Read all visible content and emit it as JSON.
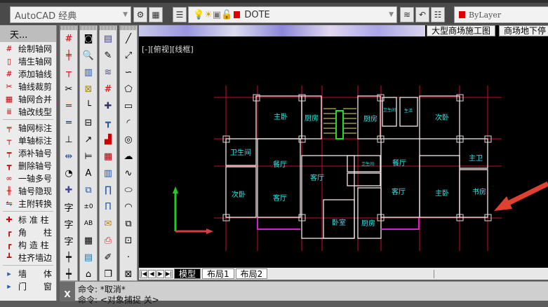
{
  "toolbar": {
    "workspace": "AutoCAD 经典",
    "layer": "DOTE",
    "color": "ByLayer",
    "layer_color": "#e00000"
  },
  "palette": {
    "title": "天...",
    "groups": [
      [
        "绘制轴网",
        "墙生轴网",
        "添加轴线",
        "轴线裁剪",
        "轴网合并",
        "轴改线型"
      ],
      [
        "轴网标注",
        "单轴标注",
        "添补轴号",
        "删除轴号",
        "一轴多号",
        "轴号隐现",
        "主附转换"
      ],
      [
        "标 准 柱",
        "角　　柱",
        "构 造 柱",
        "柱齐墙边"
      ],
      [
        "墙　　体",
        "门　　窗"
      ]
    ]
  },
  "doc_tabs": [
    "大型商场施工图",
    "商场地下停"
  ],
  "viewport_label": "[-][俯视][线框]",
  "layout_tabs": [
    "模型",
    "布局1",
    "布局2"
  ],
  "command": {
    "line1": "命令:  *取消*",
    "line2": "命令:  <对象捕捉 关>"
  },
  "rooms": {
    "master_left": "主卧",
    "kitchen_l": "厨房",
    "kitchen_r": "厨房",
    "wc_small": "卫生间",
    "living_small": "生活",
    "second_r": "次卧",
    "wc_left": "卫生间",
    "dining_l": "餐厅",
    "living_c": "客厅",
    "second_l": "次卧",
    "living_l": "客厅",
    "dining_r": "餐厅",
    "living_r": "客厅",
    "master_r": "主卧",
    "master_wc": "主卫",
    "study": "书房",
    "bedroom": "卧室",
    "kitchen_b": "厨房",
    "wc_c": "卫生间"
  }
}
